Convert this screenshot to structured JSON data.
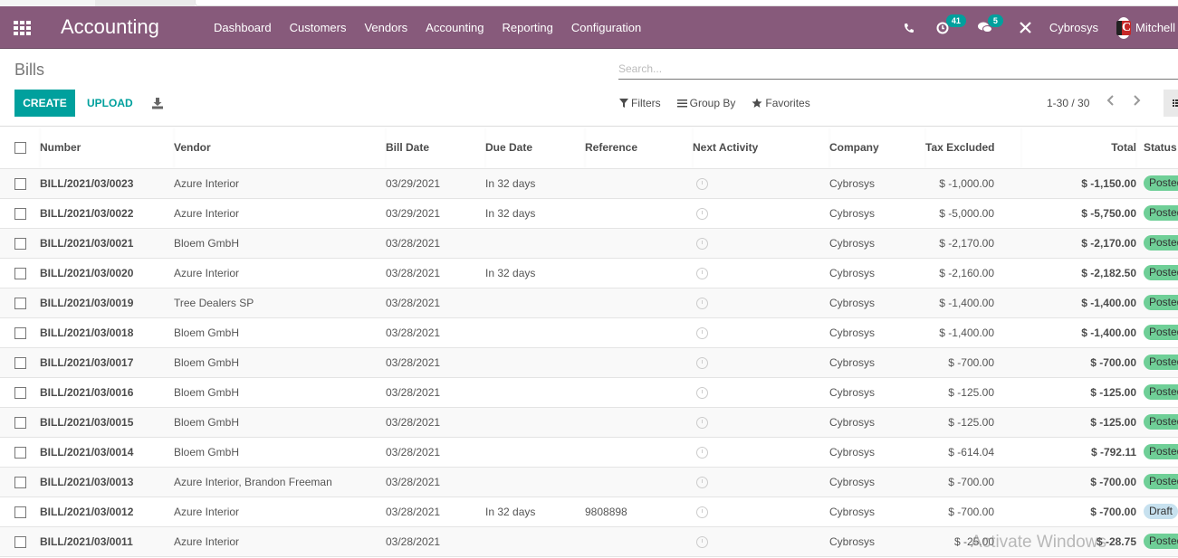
{
  "navbar": {
    "app_title": "Accounting",
    "apps_icon": "grid-apps-icon",
    "menu": [
      "Dashboard",
      "Customers",
      "Vendors",
      "Accounting",
      "Reporting",
      "Configuration"
    ],
    "systray": {
      "phone_icon": "phone-icon",
      "activities_icon": "clock-activity-icon",
      "activities_count": "41",
      "messages_icon": "chat-bubbles-icon",
      "messages_count": "5",
      "debug_icon": "tools-icon",
      "company": "Cybrosys",
      "user": "Mitchell Admin"
    },
    "colors": {
      "bar": "#875a7b",
      "badge": "#00a09d"
    }
  },
  "control_panel": {
    "breadcrumb": "Bills",
    "search_placeholder": "Search...",
    "create_label": "CREATE",
    "upload_label": "UPLOAD",
    "download_icon": "download-icon",
    "filters_label": "Filters",
    "group_by_label": "Group By",
    "favorites_label": "Favorites",
    "pager": "1-30 / 30",
    "accent": "#00a09d"
  },
  "table": {
    "columns": [
      "Number",
      "Vendor",
      "Bill Date",
      "Due Date",
      "Reference",
      "Next Activity",
      "Company",
      "Tax Excluded",
      "Total",
      "Status"
    ],
    "rows": [
      {
        "number": "BILL/2021/03/0023",
        "vendor": "Azure Interior",
        "bill_date": "03/29/2021",
        "due_date": "In 32 days",
        "reference": "",
        "company": "Cybrosys",
        "tax_excluded": "$ -1,000.00",
        "total": "$ -1,150.00",
        "status": "Posted"
      },
      {
        "number": "BILL/2021/03/0022",
        "vendor": "Azure Interior",
        "bill_date": "03/29/2021",
        "due_date": "In 32 days",
        "reference": "",
        "company": "Cybrosys",
        "tax_excluded": "$ -5,000.00",
        "total": "$ -5,750.00",
        "status": "Posted"
      },
      {
        "number": "BILL/2021/03/0021",
        "vendor": "Bloem GmbH",
        "bill_date": "03/28/2021",
        "due_date": "",
        "reference": "",
        "company": "Cybrosys",
        "tax_excluded": "$ -2,170.00",
        "total": "$ -2,170.00",
        "status": "Posted"
      },
      {
        "number": "BILL/2021/03/0020",
        "vendor": "Azure Interior",
        "bill_date": "03/28/2021",
        "due_date": "In 32 days",
        "reference": "",
        "company": "Cybrosys",
        "tax_excluded": "$ -2,160.00",
        "total": "$ -2,182.50",
        "status": "Posted"
      },
      {
        "number": "BILL/2021/03/0019",
        "vendor": "Tree Dealers SP",
        "bill_date": "03/28/2021",
        "due_date": "",
        "reference": "",
        "company": "Cybrosys",
        "tax_excluded": "$ -1,400.00",
        "total": "$ -1,400.00",
        "status": "Posted"
      },
      {
        "number": "BILL/2021/03/0018",
        "vendor": "Bloem GmbH",
        "bill_date": "03/28/2021",
        "due_date": "",
        "reference": "",
        "company": "Cybrosys",
        "tax_excluded": "$ -1,400.00",
        "total": "$ -1,400.00",
        "status": "Posted"
      },
      {
        "number": "BILL/2021/03/0017",
        "vendor": "Bloem GmbH",
        "bill_date": "03/28/2021",
        "due_date": "",
        "reference": "",
        "company": "Cybrosys",
        "tax_excluded": "$ -700.00",
        "total": "$ -700.00",
        "status": "Posted"
      },
      {
        "number": "BILL/2021/03/0016",
        "vendor": "Bloem GmbH",
        "bill_date": "03/28/2021",
        "due_date": "",
        "reference": "",
        "company": "Cybrosys",
        "tax_excluded": "$ -125.00",
        "total": "$ -125.00",
        "status": "Posted"
      },
      {
        "number": "BILL/2021/03/0015",
        "vendor": "Bloem GmbH",
        "bill_date": "03/28/2021",
        "due_date": "",
        "reference": "",
        "company": "Cybrosys",
        "tax_excluded": "$ -125.00",
        "total": "$ -125.00",
        "status": "Posted"
      },
      {
        "number": "BILL/2021/03/0014",
        "vendor": "Bloem GmbH",
        "bill_date": "03/28/2021",
        "due_date": "",
        "reference": "",
        "company": "Cybrosys",
        "tax_excluded": "$ -614.04",
        "total": "$ -792.11",
        "status": "Posted"
      },
      {
        "number": "BILL/2021/03/0013",
        "vendor": "Azure Interior, Brandon Freeman",
        "bill_date": "03/28/2021",
        "due_date": "",
        "reference": "",
        "company": "Cybrosys",
        "tax_excluded": "$ -700.00",
        "total": "$ -700.00",
        "status": "Posted"
      },
      {
        "number": "BILL/2021/03/0012",
        "vendor": "Azure Interior",
        "bill_date": "03/28/2021",
        "due_date": "In 32 days",
        "reference": "9808898",
        "company": "Cybrosys",
        "tax_excluded": "$ -700.00",
        "total": "$ -700.00",
        "status": "Draft"
      },
      {
        "number": "BILL/2021/03/0011",
        "vendor": "Azure Interior",
        "bill_date": "03/28/2021",
        "due_date": "",
        "reference": "",
        "company": "Cybrosys",
        "tax_excluded": "$ -25.00",
        "total": "$ -28.75",
        "status": "Posted"
      }
    ],
    "status_colors": {
      "Posted": "#6fcf97",
      "Draft": "#c7e1ef"
    }
  },
  "watermark": "Activate Windows"
}
